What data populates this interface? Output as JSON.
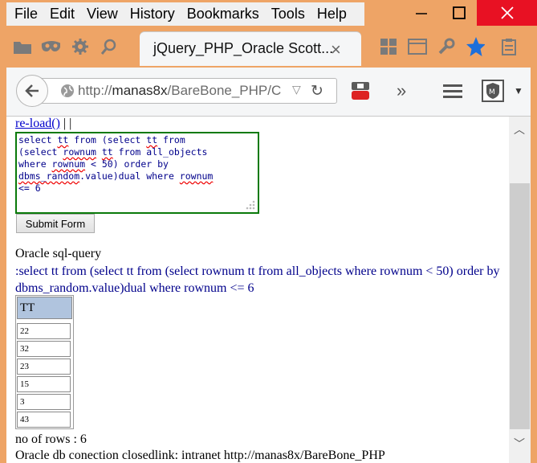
{
  "menu": [
    "File",
    "Edit",
    "View",
    "History",
    "Bookmarks",
    "Tools",
    "Help"
  ],
  "tab": {
    "title": "jQuery_PHP_Oracle Scott...",
    "close": "×"
  },
  "url": {
    "prefix": "http://",
    "host": "manas8x",
    "path": "/BareBone_PHP/C"
  },
  "page": {
    "reload_link": "re-load()",
    "reload_suffix": " | |",
    "textarea": {
      "parts": [
        "select ",
        "tt",
        " from (select ",
        "tt",
        " from\n(select ",
        "rownum",
        " ",
        "tt",
        " from all_objects\nwhere ",
        "rownum",
        " < 50) order by\n",
        "dbms_random",
        ".value)dual where ",
        "rownum",
        "\n<= 6"
      ]
    },
    "submit_label": "Submit Form",
    "oracle_heading": "Oracle sql-query",
    "query_echo": ":select tt from (select tt from (select rownum tt from all_objects where rownum < 50) order by dbms_random.value)dual where rownum <= 6",
    "table": {
      "header": "TT",
      "rows": [
        "22",
        "32",
        "23",
        "15",
        "3",
        "43"
      ]
    },
    "row_count": "no of rows : 6",
    "status_line": "Oracle db conection closedlink: intranet http://manas8x/BareBone_PHP"
  },
  "colors": {
    "titlebar": "#eea466",
    "close": "#e81123",
    "link": "#0000cc",
    "query": "#00008b",
    "textarea_border": "#0a7a0a",
    "header_bg": "#b0c4de"
  }
}
